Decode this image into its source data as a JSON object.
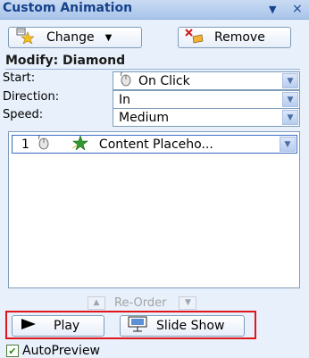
{
  "titlebar": {
    "title": "Custom Animation",
    "menu_glyph": "▼",
    "close_glyph": "×"
  },
  "toolbar": {
    "change_label": "Change",
    "remove_label": "Remove"
  },
  "modify": {
    "heading": "Modify: Diamond"
  },
  "settings": {
    "start_label": "Start:",
    "start_value": "On Click",
    "direction_label": "Direction:",
    "direction_value": "In",
    "speed_label": "Speed:",
    "speed_value": "Medium"
  },
  "animation_list": {
    "items": [
      {
        "number": "1",
        "text": "Content Placeho..."
      }
    ]
  },
  "reorder": {
    "label": "Re-Order"
  },
  "playback": {
    "play_label": "Play",
    "slideshow_label": "Slide Show"
  },
  "autopreview": {
    "label": "AutoPreview",
    "checked": true
  },
  "colors": {
    "highlight": "#e0161c",
    "title_text": "#15428b"
  }
}
